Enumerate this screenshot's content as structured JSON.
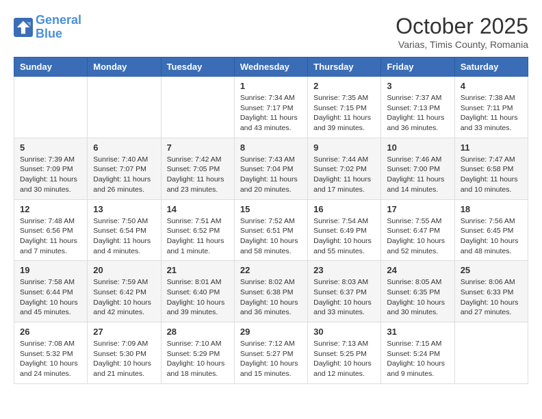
{
  "header": {
    "logo_line1": "General",
    "logo_line2": "Blue",
    "month": "October 2025",
    "location": "Varias, Timis County, Romania"
  },
  "weekdays": [
    "Sunday",
    "Monday",
    "Tuesday",
    "Wednesday",
    "Thursday",
    "Friday",
    "Saturday"
  ],
  "weeks": [
    [
      {
        "day": "",
        "info": ""
      },
      {
        "day": "",
        "info": ""
      },
      {
        "day": "",
        "info": ""
      },
      {
        "day": "1",
        "info": "Sunrise: 7:34 AM\nSunset: 7:17 PM\nDaylight: 11 hours\nand 43 minutes."
      },
      {
        "day": "2",
        "info": "Sunrise: 7:35 AM\nSunset: 7:15 PM\nDaylight: 11 hours\nand 39 minutes."
      },
      {
        "day": "3",
        "info": "Sunrise: 7:37 AM\nSunset: 7:13 PM\nDaylight: 11 hours\nand 36 minutes."
      },
      {
        "day": "4",
        "info": "Sunrise: 7:38 AM\nSunset: 7:11 PM\nDaylight: 11 hours\nand 33 minutes."
      }
    ],
    [
      {
        "day": "5",
        "info": "Sunrise: 7:39 AM\nSunset: 7:09 PM\nDaylight: 11 hours\nand 30 minutes."
      },
      {
        "day": "6",
        "info": "Sunrise: 7:40 AM\nSunset: 7:07 PM\nDaylight: 11 hours\nand 26 minutes."
      },
      {
        "day": "7",
        "info": "Sunrise: 7:42 AM\nSunset: 7:05 PM\nDaylight: 11 hours\nand 23 minutes."
      },
      {
        "day": "8",
        "info": "Sunrise: 7:43 AM\nSunset: 7:04 PM\nDaylight: 11 hours\nand 20 minutes."
      },
      {
        "day": "9",
        "info": "Sunrise: 7:44 AM\nSunset: 7:02 PM\nDaylight: 11 hours\nand 17 minutes."
      },
      {
        "day": "10",
        "info": "Sunrise: 7:46 AM\nSunset: 7:00 PM\nDaylight: 11 hours\nand 14 minutes."
      },
      {
        "day": "11",
        "info": "Sunrise: 7:47 AM\nSunset: 6:58 PM\nDaylight: 11 hours\nand 10 minutes."
      }
    ],
    [
      {
        "day": "12",
        "info": "Sunrise: 7:48 AM\nSunset: 6:56 PM\nDaylight: 11 hours\nand 7 minutes."
      },
      {
        "day": "13",
        "info": "Sunrise: 7:50 AM\nSunset: 6:54 PM\nDaylight: 11 hours\nand 4 minutes."
      },
      {
        "day": "14",
        "info": "Sunrise: 7:51 AM\nSunset: 6:52 PM\nDaylight: 11 hours\nand 1 minute."
      },
      {
        "day": "15",
        "info": "Sunrise: 7:52 AM\nSunset: 6:51 PM\nDaylight: 10 hours\nand 58 minutes."
      },
      {
        "day": "16",
        "info": "Sunrise: 7:54 AM\nSunset: 6:49 PM\nDaylight: 10 hours\nand 55 minutes."
      },
      {
        "day": "17",
        "info": "Sunrise: 7:55 AM\nSunset: 6:47 PM\nDaylight: 10 hours\nand 52 minutes."
      },
      {
        "day": "18",
        "info": "Sunrise: 7:56 AM\nSunset: 6:45 PM\nDaylight: 10 hours\nand 48 minutes."
      }
    ],
    [
      {
        "day": "19",
        "info": "Sunrise: 7:58 AM\nSunset: 6:44 PM\nDaylight: 10 hours\nand 45 minutes."
      },
      {
        "day": "20",
        "info": "Sunrise: 7:59 AM\nSunset: 6:42 PM\nDaylight: 10 hours\nand 42 minutes."
      },
      {
        "day": "21",
        "info": "Sunrise: 8:01 AM\nSunset: 6:40 PM\nDaylight: 10 hours\nand 39 minutes."
      },
      {
        "day": "22",
        "info": "Sunrise: 8:02 AM\nSunset: 6:38 PM\nDaylight: 10 hours\nand 36 minutes."
      },
      {
        "day": "23",
        "info": "Sunrise: 8:03 AM\nSunset: 6:37 PM\nDaylight: 10 hours\nand 33 minutes."
      },
      {
        "day": "24",
        "info": "Sunrise: 8:05 AM\nSunset: 6:35 PM\nDaylight: 10 hours\nand 30 minutes."
      },
      {
        "day": "25",
        "info": "Sunrise: 8:06 AM\nSunset: 6:33 PM\nDaylight: 10 hours\nand 27 minutes."
      }
    ],
    [
      {
        "day": "26",
        "info": "Sunrise: 7:08 AM\nSunset: 5:32 PM\nDaylight: 10 hours\nand 24 minutes."
      },
      {
        "day": "27",
        "info": "Sunrise: 7:09 AM\nSunset: 5:30 PM\nDaylight: 10 hours\nand 21 minutes."
      },
      {
        "day": "28",
        "info": "Sunrise: 7:10 AM\nSunset: 5:29 PM\nDaylight: 10 hours\nand 18 minutes."
      },
      {
        "day": "29",
        "info": "Sunrise: 7:12 AM\nSunset: 5:27 PM\nDaylight: 10 hours\nand 15 minutes."
      },
      {
        "day": "30",
        "info": "Sunrise: 7:13 AM\nSunset: 5:25 PM\nDaylight: 10 hours\nand 12 minutes."
      },
      {
        "day": "31",
        "info": "Sunrise: 7:15 AM\nSunset: 5:24 PM\nDaylight: 10 hours\nand 9 minutes."
      },
      {
        "day": "",
        "info": ""
      }
    ]
  ]
}
